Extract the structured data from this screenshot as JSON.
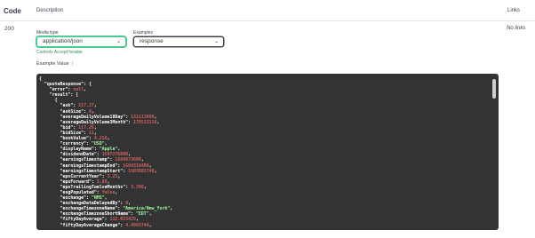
{
  "header": {
    "code": "Code",
    "description": "Description",
    "links": "Links"
  },
  "response": {
    "status": "200",
    "no_links": "No links",
    "media_type": {
      "label": "Media type",
      "value": "application/json",
      "hint": "Controls Accept header."
    },
    "examples": {
      "label": "Examples",
      "value": "response"
    },
    "example_value_label": "Example Value",
    "code_lines": [
      {
        "i": 0,
        "t": "{"
      },
      {
        "i": 1,
        "k": "\"quoteResponse\"",
        "t": ": {"
      },
      {
        "i": 2,
        "k": "\"error\"",
        "t": ": ",
        "v": "null",
        "vt": "n",
        "e": ","
      },
      {
        "i": 2,
        "k": "\"result\"",
        "t": ": ["
      },
      {
        "i": 3,
        "t": "{"
      },
      {
        "i": 4,
        "k": "\"ask\"",
        "t": ": ",
        "v": "117.27",
        "vt": "n",
        "e": ","
      },
      {
        "i": 4,
        "k": "\"askSize\"",
        "t": ": ",
        "v": "8",
        "vt": "n",
        "e": ","
      },
      {
        "i": 4,
        "k": "\"averageDailyVolume10Day\"",
        "t": ": ",
        "v": "131113800",
        "vt": "n",
        "e": ","
      },
      {
        "i": 4,
        "k": "\"averageDailyVolume3Month\"",
        "t": ": ",
        "v": "170513116",
        "vt": "n",
        "e": ","
      },
      {
        "i": 4,
        "k": "\"bid\"",
        "t": ": ",
        "v": "117.26",
        "vt": "n",
        "e": ","
      },
      {
        "i": 4,
        "k": "\"bidSize\"",
        "t": ": ",
        "v": "11",
        "vt": "n",
        "e": ","
      },
      {
        "i": 4,
        "k": "\"bookValue\"",
        "t": ": ",
        "v": "4.218",
        "vt": "n",
        "e": ","
      },
      {
        "i": 4,
        "k": "\"currency\"",
        "t": ": ",
        "v": "\"USD\"",
        "vt": "s",
        "e": ","
      },
      {
        "i": 4,
        "k": "\"displayName\"",
        "t": ": ",
        "v": "\"Apple\"",
        "vt": "s",
        "e": ","
      },
      {
        "i": 4,
        "k": "\"dividendDate\"",
        "t": ": ",
        "v": "1597276800",
        "vt": "n",
        "e": ","
      },
      {
        "i": 4,
        "k": "\"earningsTimestamp\"",
        "t": ": ",
        "v": "1604073600",
        "vt": "n",
        "e": ","
      },
      {
        "i": 4,
        "k": "\"earningsTimestampEnd\"",
        "t": ": ",
        "v": "1604318400",
        "vt": "n",
        "e": ","
      },
      {
        "i": 4,
        "k": "\"earningsTimestampStart\"",
        "t": ": ",
        "v": "1603882740",
        "vt": "n",
        "e": ","
      },
      {
        "i": 4,
        "k": "\"epsCurrentYear\"",
        "t": ": ",
        "v": "3.25",
        "vt": "n",
        "e": ","
      },
      {
        "i": 4,
        "k": "\"epsForward\"",
        "t": ": ",
        "v": "3.86",
        "vt": "n",
        "e": ","
      },
      {
        "i": 4,
        "k": "\"epsTrailingTwelveMonths\"",
        "t": ": ",
        "v": "3.296",
        "vt": "n",
        "e": ","
      },
      {
        "i": 4,
        "k": "\"esgPopulated\"",
        "t": ": ",
        "v": "false",
        "vt": "n",
        "e": ","
      },
      {
        "i": 4,
        "k": "\"exchange\"",
        "t": ": ",
        "v": "\"NMS\"",
        "vt": "s",
        "e": ","
      },
      {
        "i": 4,
        "k": "\"exchangeDataDelayedBy\"",
        "t": ": ",
        "v": "0",
        "vt": "n",
        "e": ","
      },
      {
        "i": 4,
        "k": "\"exchangeTimezoneName\"",
        "t": ": ",
        "v": "\"America/New_York\"",
        "vt": "s",
        "e": ","
      },
      {
        "i": 4,
        "k": "\"exchangeTimezoneShortName\"",
        "t": ": ",
        "v": "\"EDT\"",
        "vt": "s",
        "e": ","
      },
      {
        "i": 4,
        "k": "\"fiftyDayAverage\"",
        "t": ": ",
        "v": "112.023425",
        "vt": "n",
        "e": ","
      },
      {
        "i": 4,
        "k": "\"fiftyDayAverageChange\"",
        "t": ": ",
        "v": "4.4965744",
        "vt": "n",
        "e": ","
      }
    ]
  }
}
